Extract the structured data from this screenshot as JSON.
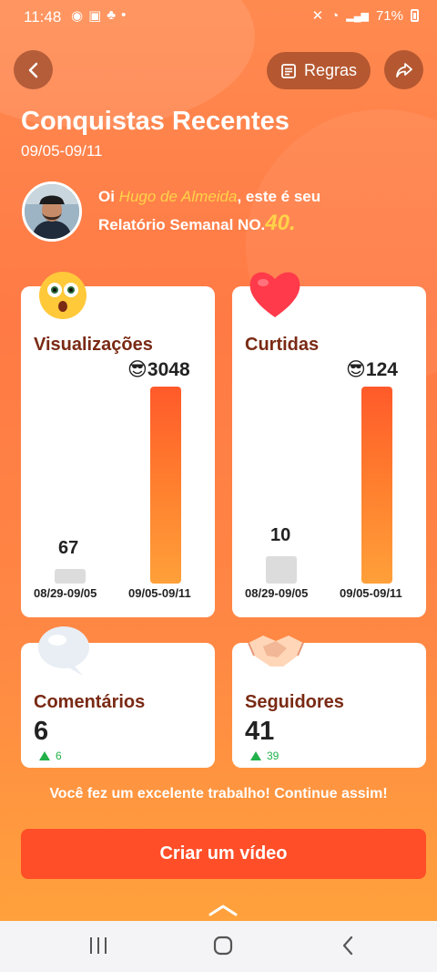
{
  "status_bar": {
    "time": "11:48",
    "battery": "71%",
    "network": "Vo)\nLTE1"
  },
  "header": {
    "rules_label": "Regras",
    "title": "Conquistas Recentes",
    "date_range": "09/05-09/11"
  },
  "greeting": {
    "prefix": "Oi ",
    "name": "Hugo de Almeida",
    "suffix": ", este é seu",
    "line2": "Relatório Semanal NO.",
    "number": "40",
    "end": "."
  },
  "cards": {
    "views": {
      "label": "Visualizações",
      "current": "3048",
      "previous": "67",
      "current_period": "09/05-09/11",
      "previous_period": "08/29-09/05"
    },
    "likes": {
      "label": "Curtidas",
      "current": "124",
      "previous": "10",
      "current_period": "09/05-09/11",
      "previous_period": "08/29-09/05"
    },
    "comments": {
      "label": "Comentários",
      "value": "6",
      "delta": "6"
    },
    "followers": {
      "label": "Seguidores",
      "value": "41",
      "delta": "39"
    }
  },
  "footer": {
    "message": "Você fez um excelente trabalho! Continue assim!",
    "cta_label": "Criar um vídeo"
  },
  "colors": {
    "accent": "#ff4e28",
    "bar": "#ff6a2a",
    "gain": "#22b04a",
    "label": "#7a2a14"
  }
}
